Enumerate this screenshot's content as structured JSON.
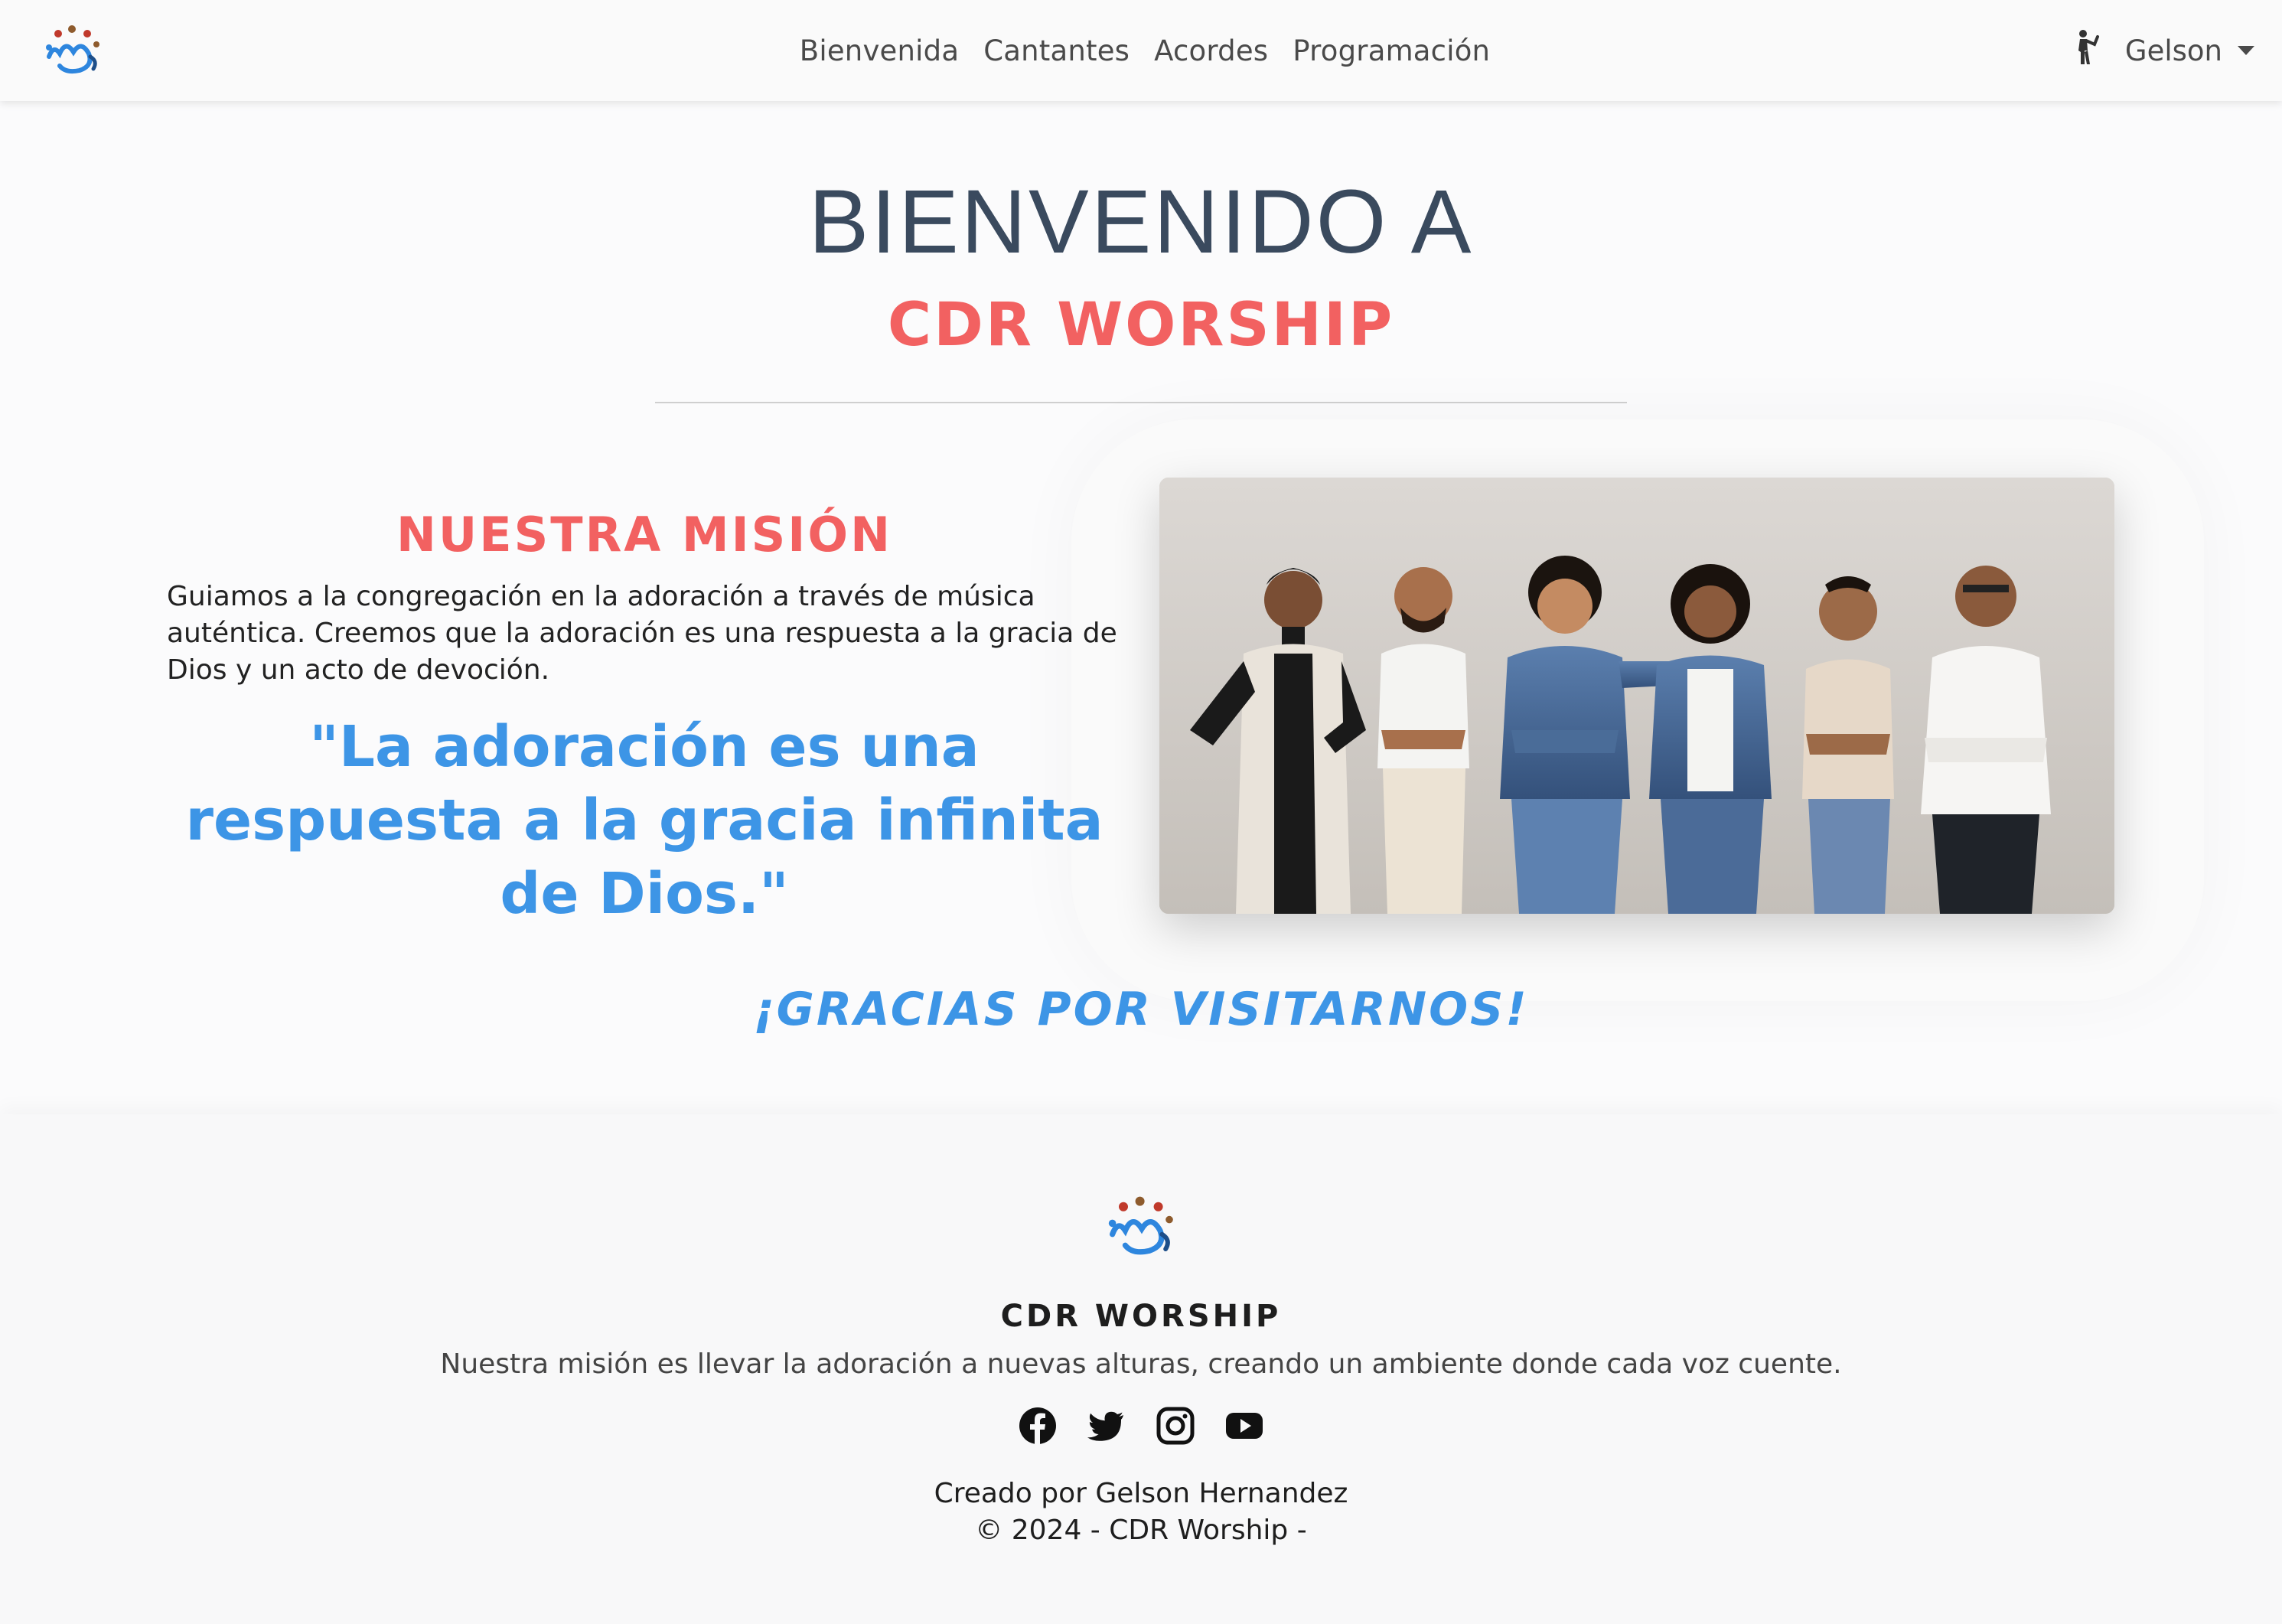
{
  "navbar": {
    "logo_icon": "cdr-worship-logo",
    "links": [
      "Bienvenida",
      "Cantantes",
      "Acordes",
      "Programación"
    ],
    "user_icon": "person-waving-icon",
    "user_name": "Gelson",
    "dropdown_icon": "caret-down-icon"
  },
  "hero": {
    "title": "BIENVENIDO A",
    "subtitle": "CDR WORSHIP"
  },
  "mission": {
    "heading": "NUESTRA MISIÓN",
    "text": "Guiamos a la congregación en la adoración a través de música auténtica. Creemos que la adoración es una respuesta a la gracia de Dios y un acto de devoción.",
    "quote": "\"La adoración es una respuesta a la gracia infinita de Dios.\"",
    "photo": "team-photo"
  },
  "thanks": "¡GRACIAS POR VISITARNOS!",
  "footer": {
    "brand": "CDR WORSHIP",
    "mission": "Nuestra misión es llevar la adoración a nuevas alturas, creando un ambiente donde cada voz cuente.",
    "socials": [
      "facebook-icon",
      "twitter-icon",
      "instagram-icon",
      "youtube-icon"
    ],
    "credit": "Creado por Gelson Hernandez",
    "copyright": "© 2024 - CDR Worship -"
  },
  "colors": {
    "accent_red": "#f26161",
    "accent_blue": "#3d95e6",
    "title_slate": "#3a4a5e"
  }
}
